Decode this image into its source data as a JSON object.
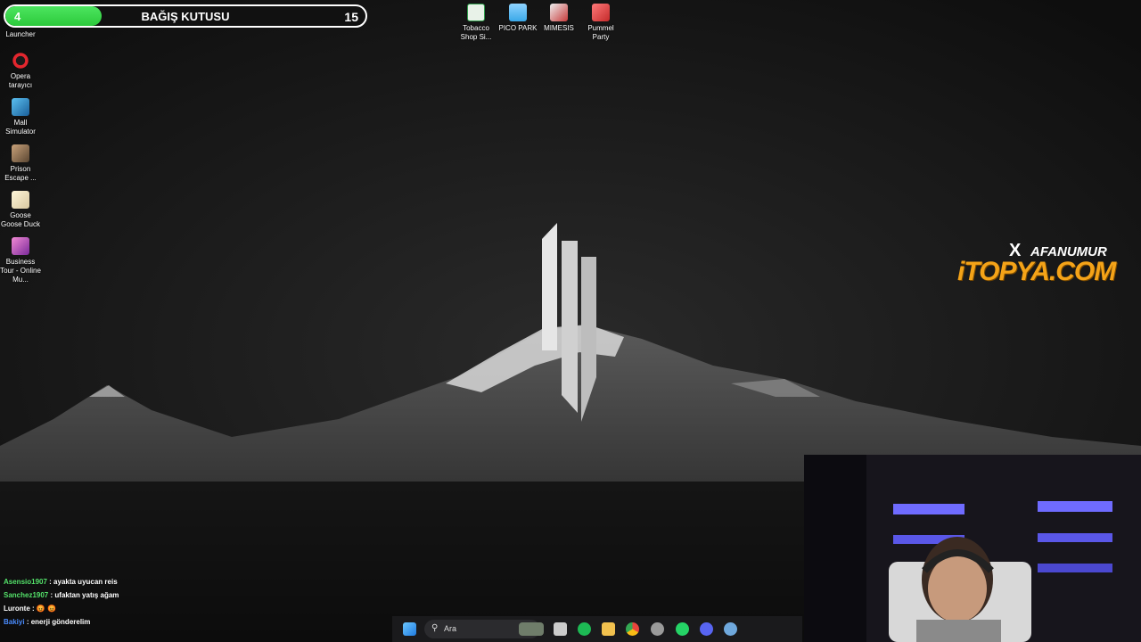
{
  "donation_bar": {
    "count": "4",
    "title": "BAĞIŞ KUTUSU",
    "goal": "15",
    "progress_fraction": 0.267,
    "color": "#36d04a"
  },
  "desktop_left_icons": [
    {
      "label": "Launcher",
      "icon": "game-launcher-icon",
      "color": "#3a7bd5"
    },
    {
      "label": "Opera tarayıcı",
      "icon": "opera-icon",
      "color": "#e3262e"
    },
    {
      "label": "Mall Simulator",
      "icon": "mall-simulator-icon",
      "color": "#3aa0d8"
    },
    {
      "label": "Prison Escape ...",
      "icon": "prison-escape-icon",
      "color": "#9a7a5a"
    },
    {
      "label": "Goose Goose Duck",
      "icon": "goose-goose-duck-icon",
      "color": "#f0e6c8"
    },
    {
      "label": "Business Tour - Online Mu...",
      "icon": "business-tour-icon",
      "color": "#d04ab0"
    }
  ],
  "desktop_top_icons": [
    {
      "label": "Tobacco Shop Si...",
      "icon": "tobacco-shop-icon",
      "color": "#2e9b4a"
    },
    {
      "label": "PICO PARK",
      "icon": "pico-park-icon",
      "color": "#3aa8e8"
    },
    {
      "label": "MIMESIS",
      "icon": "mimesis-icon",
      "color": "#c83a3a"
    },
    {
      "label": "Pummel Party",
      "icon": "pummel-party-icon",
      "color": "#e04848"
    }
  ],
  "brand": {
    "x_symbol": "X",
    "handle": "AFANUMUR",
    "logo_text": "iTOPYA.COM",
    "logo_color": "#f4a318"
  },
  "chat": [
    {
      "user": "Asensio1907",
      "text": ": ayakta uyucan reis",
      "color": "#54e26a"
    },
    {
      "user": "Sanchez1907",
      "text": ": ufaktan yatış ağam",
      "color": "#54e26a"
    },
    {
      "user": "Luronte",
      "text": ": 😡 😡",
      "color": "#ffffff"
    },
    {
      "user": "Bakiyi",
      "text": ": enerji gönderelim",
      "color": "#4a8cff"
    }
  ],
  "taskbar": {
    "search_placeholder": "Ara",
    "apps": [
      {
        "name": "start-icon",
        "color": "#3ea6ff"
      },
      {
        "name": "widgets-icon",
        "color": "#6f7d6a"
      },
      {
        "name": "task-view-icon",
        "color": "#cccccc"
      },
      {
        "name": "spotify-icon",
        "color": "#1db954"
      },
      {
        "name": "file-explorer-icon",
        "color": "#f2c14e"
      },
      {
        "name": "chrome-icon",
        "color": "#e8453c"
      },
      {
        "name": "obs-icon",
        "color": "#9a9a9a"
      },
      {
        "name": "whatsapp-icon",
        "color": "#25d366"
      },
      {
        "name": "discord-icon",
        "color": "#5865f2"
      },
      {
        "name": "steam-icon",
        "color": "#6fa8dc"
      }
    ]
  }
}
